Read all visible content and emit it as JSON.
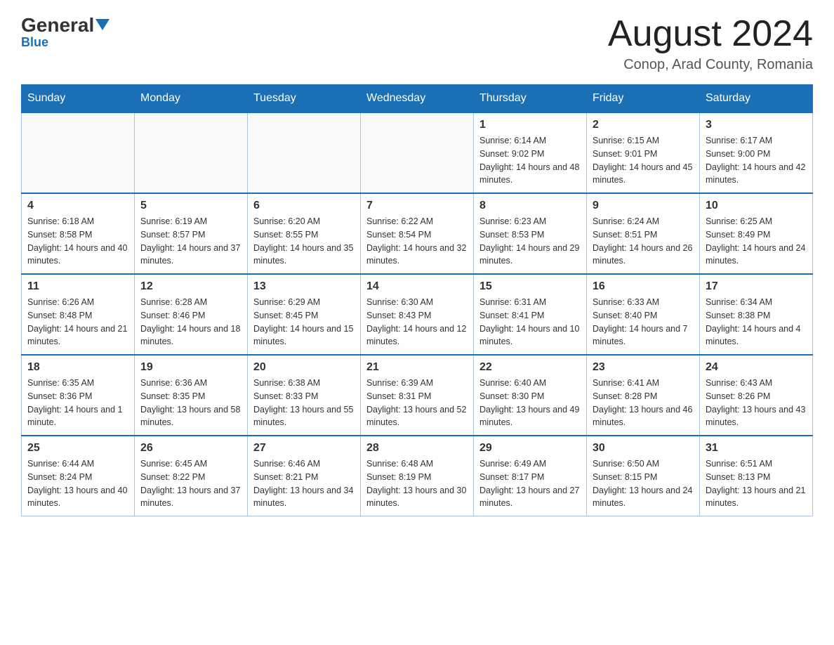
{
  "header": {
    "logo_main": "General",
    "logo_sub": "Blue",
    "title": "August 2024",
    "location": "Conop, Arad County, Romania"
  },
  "days_of_week": [
    "Sunday",
    "Monday",
    "Tuesday",
    "Wednesday",
    "Thursday",
    "Friday",
    "Saturday"
  ],
  "weeks": [
    [
      {
        "day": "",
        "info": ""
      },
      {
        "day": "",
        "info": ""
      },
      {
        "day": "",
        "info": ""
      },
      {
        "day": "",
        "info": ""
      },
      {
        "day": "1",
        "info": "Sunrise: 6:14 AM\nSunset: 9:02 PM\nDaylight: 14 hours and 48 minutes."
      },
      {
        "day": "2",
        "info": "Sunrise: 6:15 AM\nSunset: 9:01 PM\nDaylight: 14 hours and 45 minutes."
      },
      {
        "day": "3",
        "info": "Sunrise: 6:17 AM\nSunset: 9:00 PM\nDaylight: 14 hours and 42 minutes."
      }
    ],
    [
      {
        "day": "4",
        "info": "Sunrise: 6:18 AM\nSunset: 8:58 PM\nDaylight: 14 hours and 40 minutes."
      },
      {
        "day": "5",
        "info": "Sunrise: 6:19 AM\nSunset: 8:57 PM\nDaylight: 14 hours and 37 minutes."
      },
      {
        "day": "6",
        "info": "Sunrise: 6:20 AM\nSunset: 8:55 PM\nDaylight: 14 hours and 35 minutes."
      },
      {
        "day": "7",
        "info": "Sunrise: 6:22 AM\nSunset: 8:54 PM\nDaylight: 14 hours and 32 minutes."
      },
      {
        "day": "8",
        "info": "Sunrise: 6:23 AM\nSunset: 8:53 PM\nDaylight: 14 hours and 29 minutes."
      },
      {
        "day": "9",
        "info": "Sunrise: 6:24 AM\nSunset: 8:51 PM\nDaylight: 14 hours and 26 minutes."
      },
      {
        "day": "10",
        "info": "Sunrise: 6:25 AM\nSunset: 8:49 PM\nDaylight: 14 hours and 24 minutes."
      }
    ],
    [
      {
        "day": "11",
        "info": "Sunrise: 6:26 AM\nSunset: 8:48 PM\nDaylight: 14 hours and 21 minutes."
      },
      {
        "day": "12",
        "info": "Sunrise: 6:28 AM\nSunset: 8:46 PM\nDaylight: 14 hours and 18 minutes."
      },
      {
        "day": "13",
        "info": "Sunrise: 6:29 AM\nSunset: 8:45 PM\nDaylight: 14 hours and 15 minutes."
      },
      {
        "day": "14",
        "info": "Sunrise: 6:30 AM\nSunset: 8:43 PM\nDaylight: 14 hours and 12 minutes."
      },
      {
        "day": "15",
        "info": "Sunrise: 6:31 AM\nSunset: 8:41 PM\nDaylight: 14 hours and 10 minutes."
      },
      {
        "day": "16",
        "info": "Sunrise: 6:33 AM\nSunset: 8:40 PM\nDaylight: 14 hours and 7 minutes."
      },
      {
        "day": "17",
        "info": "Sunrise: 6:34 AM\nSunset: 8:38 PM\nDaylight: 14 hours and 4 minutes."
      }
    ],
    [
      {
        "day": "18",
        "info": "Sunrise: 6:35 AM\nSunset: 8:36 PM\nDaylight: 14 hours and 1 minute."
      },
      {
        "day": "19",
        "info": "Sunrise: 6:36 AM\nSunset: 8:35 PM\nDaylight: 13 hours and 58 minutes."
      },
      {
        "day": "20",
        "info": "Sunrise: 6:38 AM\nSunset: 8:33 PM\nDaylight: 13 hours and 55 minutes."
      },
      {
        "day": "21",
        "info": "Sunrise: 6:39 AM\nSunset: 8:31 PM\nDaylight: 13 hours and 52 minutes."
      },
      {
        "day": "22",
        "info": "Sunrise: 6:40 AM\nSunset: 8:30 PM\nDaylight: 13 hours and 49 minutes."
      },
      {
        "day": "23",
        "info": "Sunrise: 6:41 AM\nSunset: 8:28 PM\nDaylight: 13 hours and 46 minutes."
      },
      {
        "day": "24",
        "info": "Sunrise: 6:43 AM\nSunset: 8:26 PM\nDaylight: 13 hours and 43 minutes."
      }
    ],
    [
      {
        "day": "25",
        "info": "Sunrise: 6:44 AM\nSunset: 8:24 PM\nDaylight: 13 hours and 40 minutes."
      },
      {
        "day": "26",
        "info": "Sunrise: 6:45 AM\nSunset: 8:22 PM\nDaylight: 13 hours and 37 minutes."
      },
      {
        "day": "27",
        "info": "Sunrise: 6:46 AM\nSunset: 8:21 PM\nDaylight: 13 hours and 34 minutes."
      },
      {
        "day": "28",
        "info": "Sunrise: 6:48 AM\nSunset: 8:19 PM\nDaylight: 13 hours and 30 minutes."
      },
      {
        "day": "29",
        "info": "Sunrise: 6:49 AM\nSunset: 8:17 PM\nDaylight: 13 hours and 27 minutes."
      },
      {
        "day": "30",
        "info": "Sunrise: 6:50 AM\nSunset: 8:15 PM\nDaylight: 13 hours and 24 minutes."
      },
      {
        "day": "31",
        "info": "Sunrise: 6:51 AM\nSunset: 8:13 PM\nDaylight: 13 hours and 21 minutes."
      }
    ]
  ]
}
